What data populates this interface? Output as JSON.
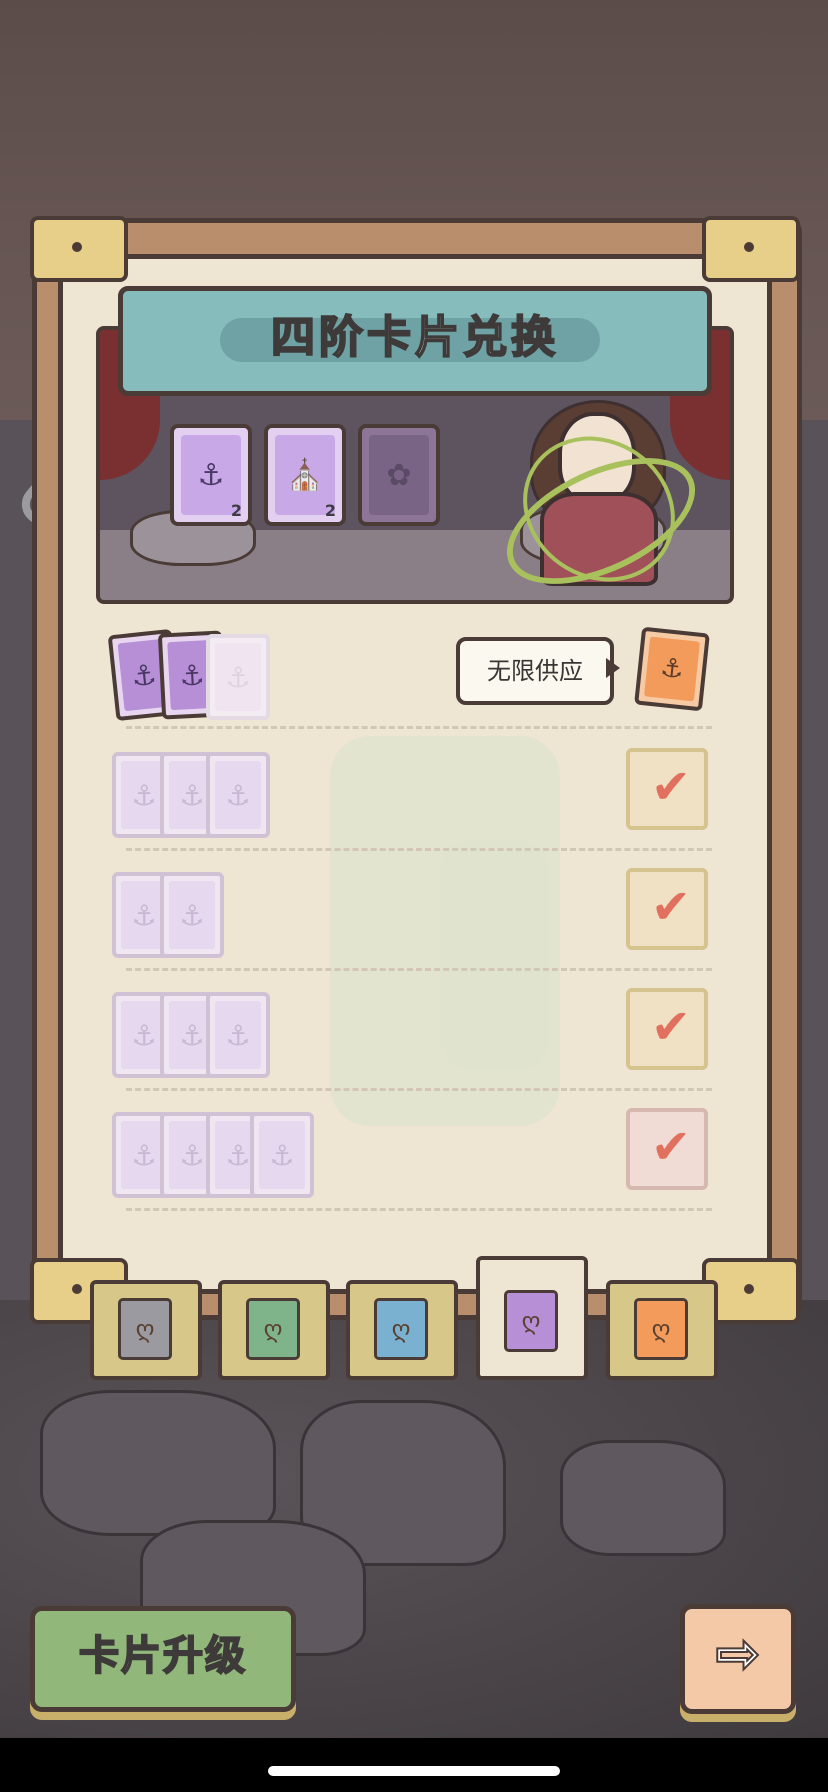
{
  "header": {
    "title": "四阶卡片兑换",
    "ingredients": [
      {
        "icon": "anchor-icon",
        "symbol": "⚓",
        "count": "2"
      },
      {
        "icon": "palace-icon",
        "symbol": "⛪",
        "count": "2"
      },
      {
        "icon": "wreath-icon",
        "symbol": "✿",
        "count": ""
      }
    ]
  },
  "supply": {
    "tooltip": "无限供应",
    "card_icon": "anchor-icon"
  },
  "rows": [
    {
      "cards_active": 2,
      "cards_total": 3,
      "state": "supply"
    },
    {
      "cards_active": 0,
      "cards_total": 3,
      "state": "claimed"
    },
    {
      "cards_active": 0,
      "cards_total": 2,
      "state": "claimed"
    },
    {
      "cards_active": 0,
      "cards_total": 3,
      "state": "claimed"
    },
    {
      "cards_active": 0,
      "cards_total": 4,
      "state": "claimed"
    }
  ],
  "check_mark": "✔",
  "tabs": [
    {
      "name": "tab-gray",
      "color": "#9a9aa0",
      "symbol": "ღ"
    },
    {
      "name": "tab-green",
      "color": "#7fb38a",
      "symbol": "ღ"
    },
    {
      "name": "tab-blue",
      "color": "#7ab0d0",
      "symbol": "ღ"
    },
    {
      "name": "tab-purple",
      "color": "#b68fd6",
      "symbol": "ღ"
    },
    {
      "name": "tab-orange",
      "color": "#f29b5a",
      "symbol": "ღ"
    }
  ],
  "active_tab": 3,
  "buttons": {
    "upgrade_label": "卡片升级",
    "next_symbol": "⇨"
  }
}
